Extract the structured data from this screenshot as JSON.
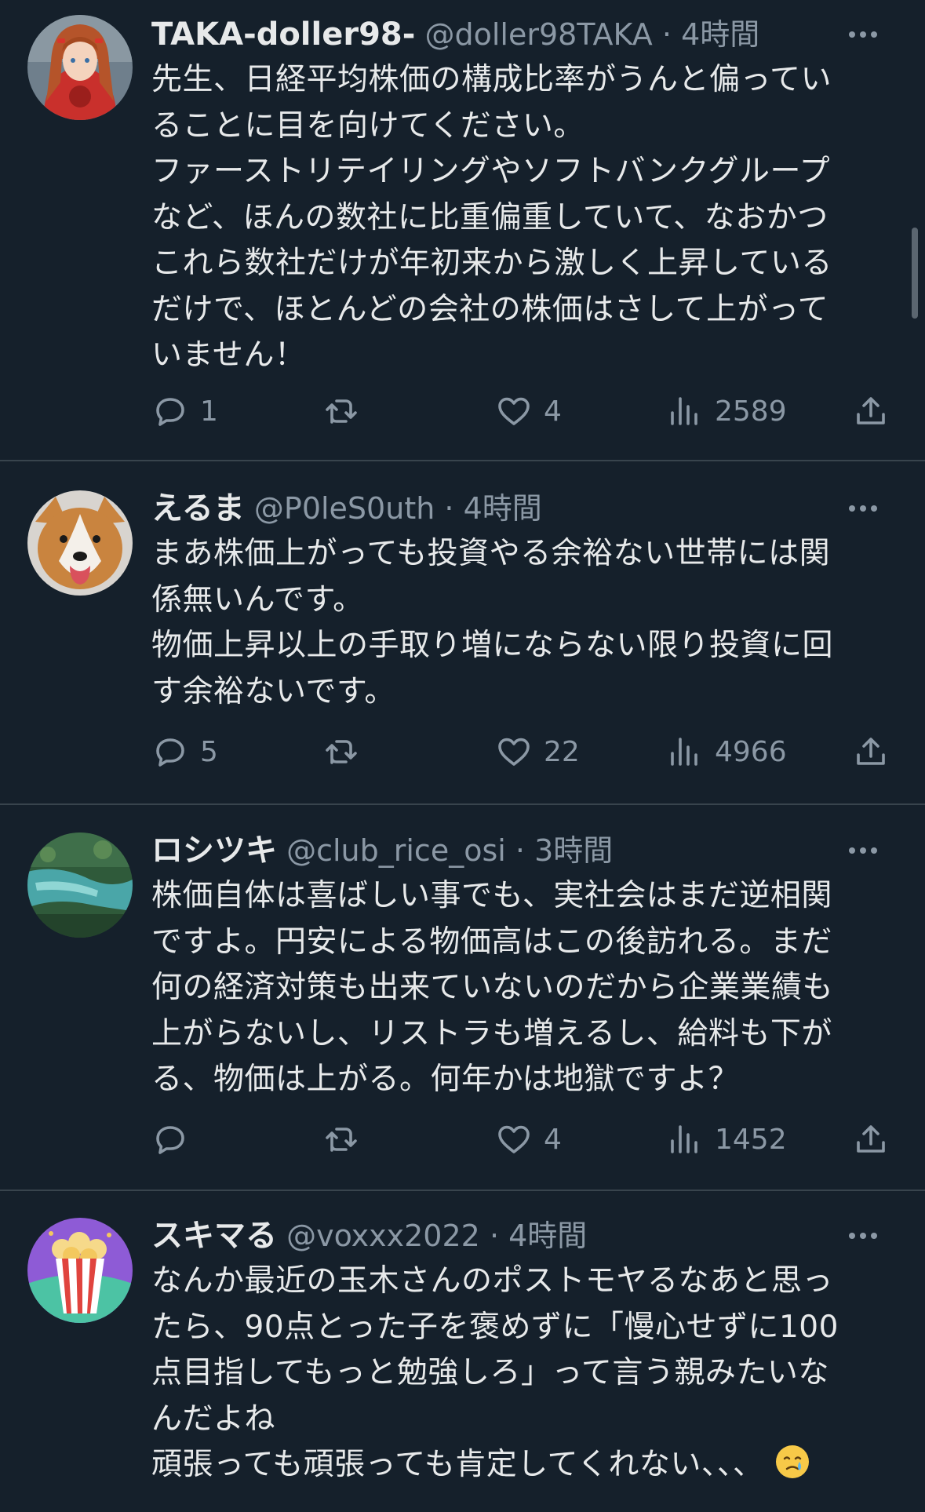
{
  "colors": {
    "background": "#15202b",
    "divider": "#38444d",
    "text_primary": "#e7e9ea",
    "text_secondary": "#8b98a5"
  },
  "icons": {
    "reply": "reply-icon",
    "retweet": "retweet-icon",
    "like": "heart-icon",
    "views": "views-icon",
    "share": "share-icon",
    "more": "more-icon"
  },
  "tweets": [
    {
      "display_name": "TAKA-doller98-",
      "handle": "@doller98TAKA",
      "separator": "·",
      "time": "4時間",
      "text": "先生、日経平均株価の構成比率がうんと偏ってい\nることに目を向けてください。\nファーストリテイリングやソフトバンクグループ\nなど、ほんの数社に比重偏重していて、なおかつ\nこれら数社だけが年初来から激しく上昇している\nだけで、ほとんどの会社の株価はさして上がって\nいません！",
      "replies": "1",
      "retweets": "",
      "likes": "4",
      "views": "2589",
      "avatar": "anime-character-avatar"
    },
    {
      "display_name": "えるま",
      "handle": "@P0leS0uth",
      "separator": "·",
      "time": "4時間",
      "text": "まあ株価上がっても投資やる余裕ない世帯には関\n係無いんです。\n物価上昇以上の手取り増にならない限り投資に回\nす余裕ないです。",
      "replies": "5",
      "retweets": "",
      "likes": "22",
      "views": "4966",
      "avatar": "corgi-dog-avatar"
    },
    {
      "display_name": "ロシツキ",
      "handle": "@club_rice_osi",
      "separator": "·",
      "time": "3時間",
      "text": "株価自体は喜ばしい事でも、実社会はまだ逆相関\nですよ。円安による物価高はこの後訪れる。まだ\n何の経済対策も出来ていないのだから企業業績も\n上がらないし、リストラも増えるし、給料も下が\nる、物価は上がる。何年かは地獄ですよ？",
      "replies": "",
      "retweets": "",
      "likes": "4",
      "views": "1452",
      "avatar": "nature-water-avatar"
    },
    {
      "display_name": "スキマる",
      "handle": "@voxxx2022",
      "separator": "·",
      "time": "4時間",
      "text": "なんか最近の玉木さんのポストモヤるなあと思っ\nたら、90点とった子を褒めずに「慢心せずに100\n点目指してもっと勉強しろ」って言う親みたいな\nんだよね\n頑張っても頑張っても肯定してくれない、、、",
      "emoji": "crying-face-emoji",
      "avatar": "popcorn-avatar"
    }
  ]
}
